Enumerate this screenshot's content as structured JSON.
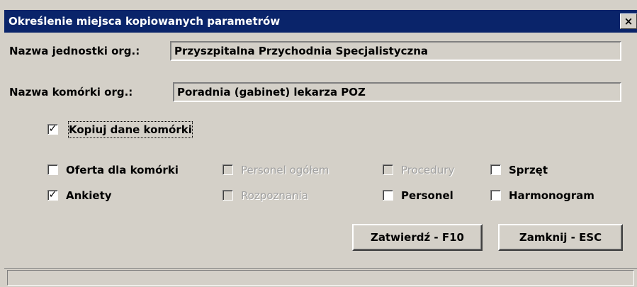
{
  "window": {
    "title": "Określenie miejsca kopiowanych parametrów",
    "close_symbol": "×"
  },
  "form": {
    "unit_label": "Nazwa jednostki org.:",
    "unit_value": "Przyszpitalna Przychodnia Specjalistyczna",
    "cell_label": "Nazwa komórki org.:",
    "cell_value": "Poradnia (gabinet) lekarza POZ"
  },
  "options": {
    "copy_cell": {
      "label": "Kopiuj dane komórki",
      "checked": true,
      "enabled": true
    },
    "offer": {
      "label": "Oferta dla komórki",
      "checked": false,
      "enabled": true
    },
    "staff_total": {
      "label": "Personel ogółem",
      "checked": false,
      "enabled": false
    },
    "procedures": {
      "label": "Procedury",
      "checked": false,
      "enabled": false
    },
    "equipment": {
      "label": "Sprzęt",
      "checked": false,
      "enabled": true
    },
    "surveys": {
      "label": "Ankiety",
      "checked": true,
      "enabled": true
    },
    "diagnoses": {
      "label": "Rozpoznania",
      "checked": false,
      "enabled": false
    },
    "staff": {
      "label": "Personel",
      "checked": false,
      "enabled": true
    },
    "schedule": {
      "label": "Harmonogram",
      "checked": false,
      "enabled": true
    }
  },
  "buttons": {
    "confirm_label": "Zatwierdź - F10",
    "close_label": "Zamknij - ESC"
  },
  "check_glyph": "✓",
  "colors": {
    "titlebar": "#0a246a",
    "face": "#d4d0c8"
  }
}
